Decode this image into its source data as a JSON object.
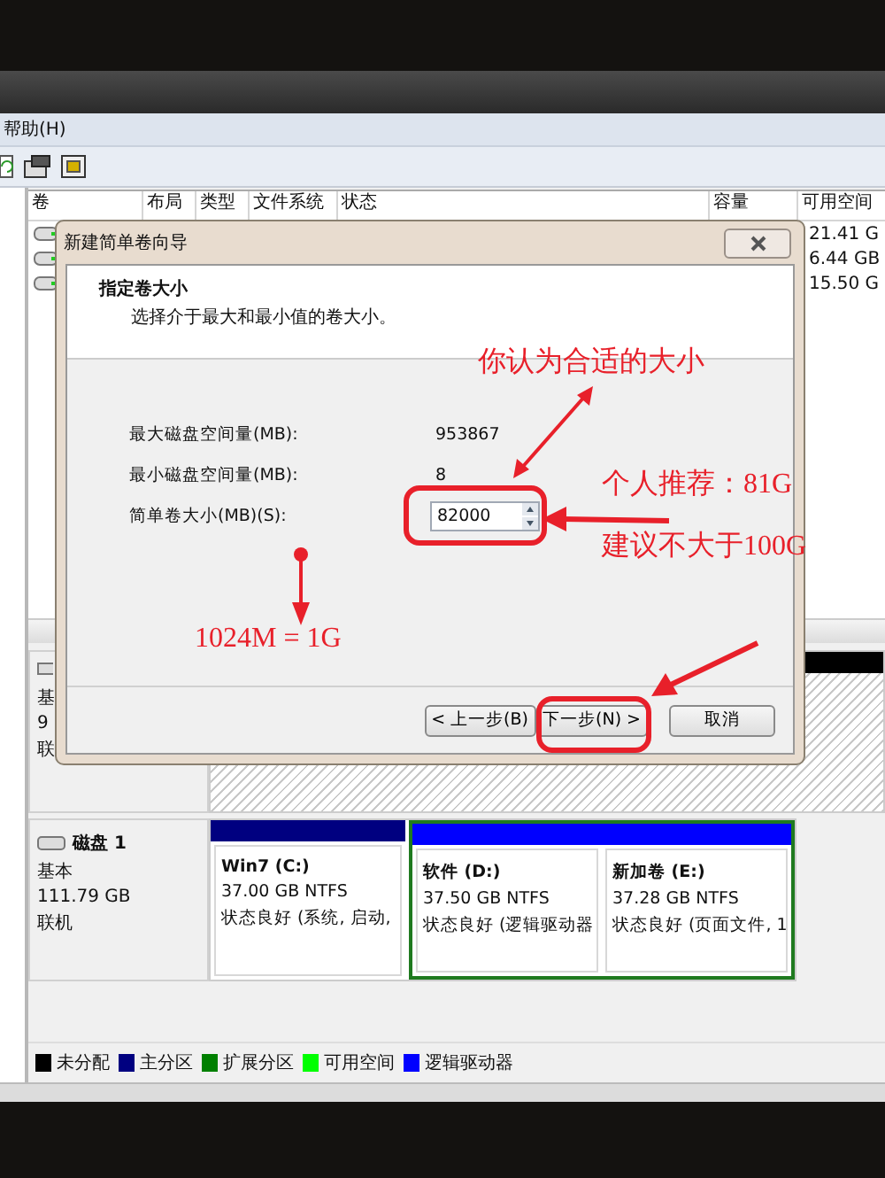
{
  "menu": [
    {
      "label": "帮助(H)"
    }
  ],
  "volume_list": {
    "columns": [
      "卷",
      "布局",
      "类型",
      "文件系统",
      "状态",
      "容量",
      "可用空间"
    ],
    "rows": [
      {
        "free_space": "21.41 G"
      },
      {
        "free_space": "6.44 GB"
      },
      {
        "free_space": "15.50 G"
      }
    ]
  },
  "disk_0": {
    "lines": [
      "基",
      "9",
      "联"
    ]
  },
  "disk_1": {
    "name": "磁盘 1",
    "type": "基本",
    "size": "111.79 GB",
    "status": "联机",
    "partitions": [
      {
        "kind": "primary",
        "title": "Win7  (C:)",
        "size": "37.00 GB NTFS",
        "status": "状态良好 (系统, 启动,",
        "color": "#000080"
      },
      {
        "kind": "logical",
        "title": "软件  (D:)",
        "size": "37.50 GB NTFS",
        "status": "状态良好 (逻辑驱动器",
        "color": "#0000ff"
      },
      {
        "kind": "logical",
        "title": "新加卷  (E:)",
        "size": "37.28 GB NTFS",
        "status": "状态良好 (页面文件, 1",
        "color": "#0000ff"
      }
    ]
  },
  "legend": [
    {
      "label": "未分配",
      "color": "#000000"
    },
    {
      "label": "主分区",
      "color": "#000080"
    },
    {
      "label": "扩展分区",
      "color": "#008000"
    },
    {
      "label": "可用空间",
      "color": "#00ff00"
    },
    {
      "label": "逻辑驱动器",
      "color": "#0000ff"
    }
  ],
  "dialog": {
    "title": "新建简单卷向导",
    "heading": "指定卷大小",
    "subtitle": "选择介于最大和最小值的卷大小。",
    "fields": [
      {
        "kind": "readout",
        "label": "最大磁盘空间量(MB):",
        "value": "953867"
      },
      {
        "kind": "readout",
        "label": "最小磁盘空间量(MB):",
        "value": "8"
      },
      {
        "kind": "spinbox",
        "label": "简单卷大小(MB)(S):",
        "value": "82000"
      }
    ],
    "buttons": [
      {
        "label": "< 上一步(B)"
      },
      {
        "label": "下一步(N) >"
      },
      {
        "label": "取消"
      }
    ]
  },
  "annotations": [
    {
      "text": "你认为合适的大小"
    },
    {
      "text": "个人推荐：81G"
    },
    {
      "text": "建议不大于100G"
    },
    {
      "text": "1024M = 1G"
    }
  ]
}
